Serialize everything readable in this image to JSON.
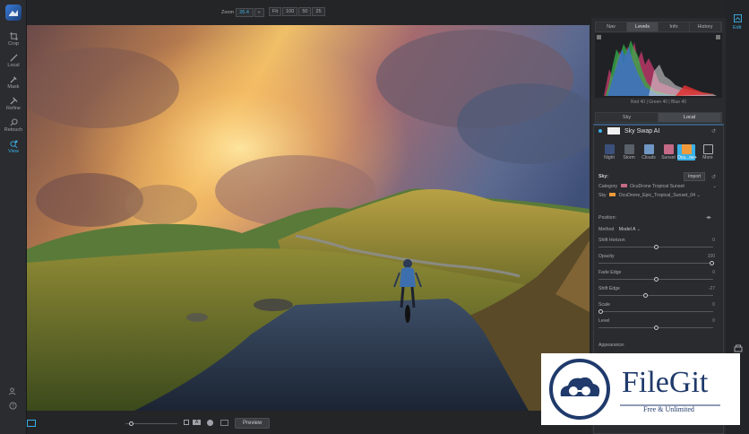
{
  "left_toolbar": {
    "tools": [
      {
        "label": "Crop",
        "icon": "crop-icon"
      },
      {
        "label": "Local",
        "icon": "brush-icon"
      },
      {
        "label": "Mask",
        "icon": "mask-icon"
      },
      {
        "label": "Refine",
        "icon": "refine-icon"
      },
      {
        "label": "Retouch",
        "icon": "retouch-icon"
      },
      {
        "label": "View",
        "icon": "view-icon"
      }
    ]
  },
  "topbar": {
    "zoom_label": "Zoom",
    "zoom_value": "26.4",
    "zoom_buttons": [
      "Fit",
      "100",
      "50",
      "25"
    ]
  },
  "bottombar": {
    "preview_label": "Preview"
  },
  "right_panel": {
    "edit_label": "Edit",
    "tabs": [
      "Nav",
      "Levels",
      "Info",
      "History"
    ],
    "selected_tab": "Levels",
    "histogram_readout": "Red  40  | Green  40  | Blue  40",
    "mode_tabs": [
      "Sky",
      "Local"
    ],
    "selected_mode": "Local",
    "module_title": "Sky Swap AI",
    "presets": [
      "Night",
      "Storm",
      "Clouds",
      "Sunset",
      "Ocu...ne+",
      "More"
    ],
    "sky_section_label": "Sky:",
    "import_label": "Import",
    "category_label": "Category",
    "category_value": "OcuDrone Tropical Sunset",
    "sky_label": "Sky",
    "sky_value": "OcuDrone_Epic_Tropical_Sunset_04",
    "position_label": "Position:",
    "method_label": "Method",
    "method_value": "Model A",
    "sliders": [
      {
        "label": "Shift Horizon",
        "value": "0",
        "level": 0.5
      },
      {
        "label": "Opacity",
        "value": "100",
        "level": 1.0
      },
      {
        "label": "Fade Edge",
        "value": "0",
        "level": 0.5
      },
      {
        "label": "Shift Edge",
        "value": "-27",
        "level": 0.4
      },
      {
        "label": "Scale",
        "value": "0",
        "level": 0.0
      },
      {
        "label": "Level",
        "value": "0",
        "level": 0.5
      }
    ],
    "appearance_label": "Appearance:"
  },
  "watermark": {
    "title": "FileGit",
    "subtitle": "Free & Unlimited"
  },
  "colors": {
    "accent": "#3ab0e6",
    "panel": "#2a2b2e"
  }
}
